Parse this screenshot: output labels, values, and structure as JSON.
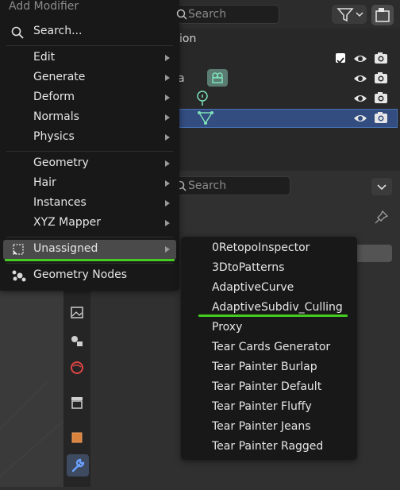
{
  "outliner": {
    "search_placeholder": "Search",
    "header_fragment": "ion",
    "row_1_fragment": "a"
  },
  "properties": {
    "search_placeholder": "Search"
  },
  "menu": {
    "title": "Add Modifier",
    "search_label": "Search...",
    "groups": {
      "edit": "Edit",
      "generate": "Generate",
      "deform": "Deform",
      "normals": "Normals",
      "physics": "Physics",
      "geometry": "Geometry",
      "hair": "Hair",
      "instances": "Instances",
      "xyz_mapper": "XYZ Mapper",
      "unassigned": "Unassigned",
      "geometry_nodes": "Geometry Nodes"
    }
  },
  "submenu": {
    "items": [
      "0RetopoInspector",
      "3DtoPatterns",
      "AdaptiveCurve",
      "AdaptiveSubdiv_Culling",
      "Proxy",
      "Tear Cards Generator",
      "Tear Painter Burlap",
      "Tear Painter Default",
      "Tear Painter Fluffy",
      "Tear Painter Jeans",
      "Tear Painter Ragged"
    ]
  },
  "colors": {
    "highlight_underline": "#44cc22",
    "selection": "#334d80",
    "menu_bg": "#181818"
  }
}
